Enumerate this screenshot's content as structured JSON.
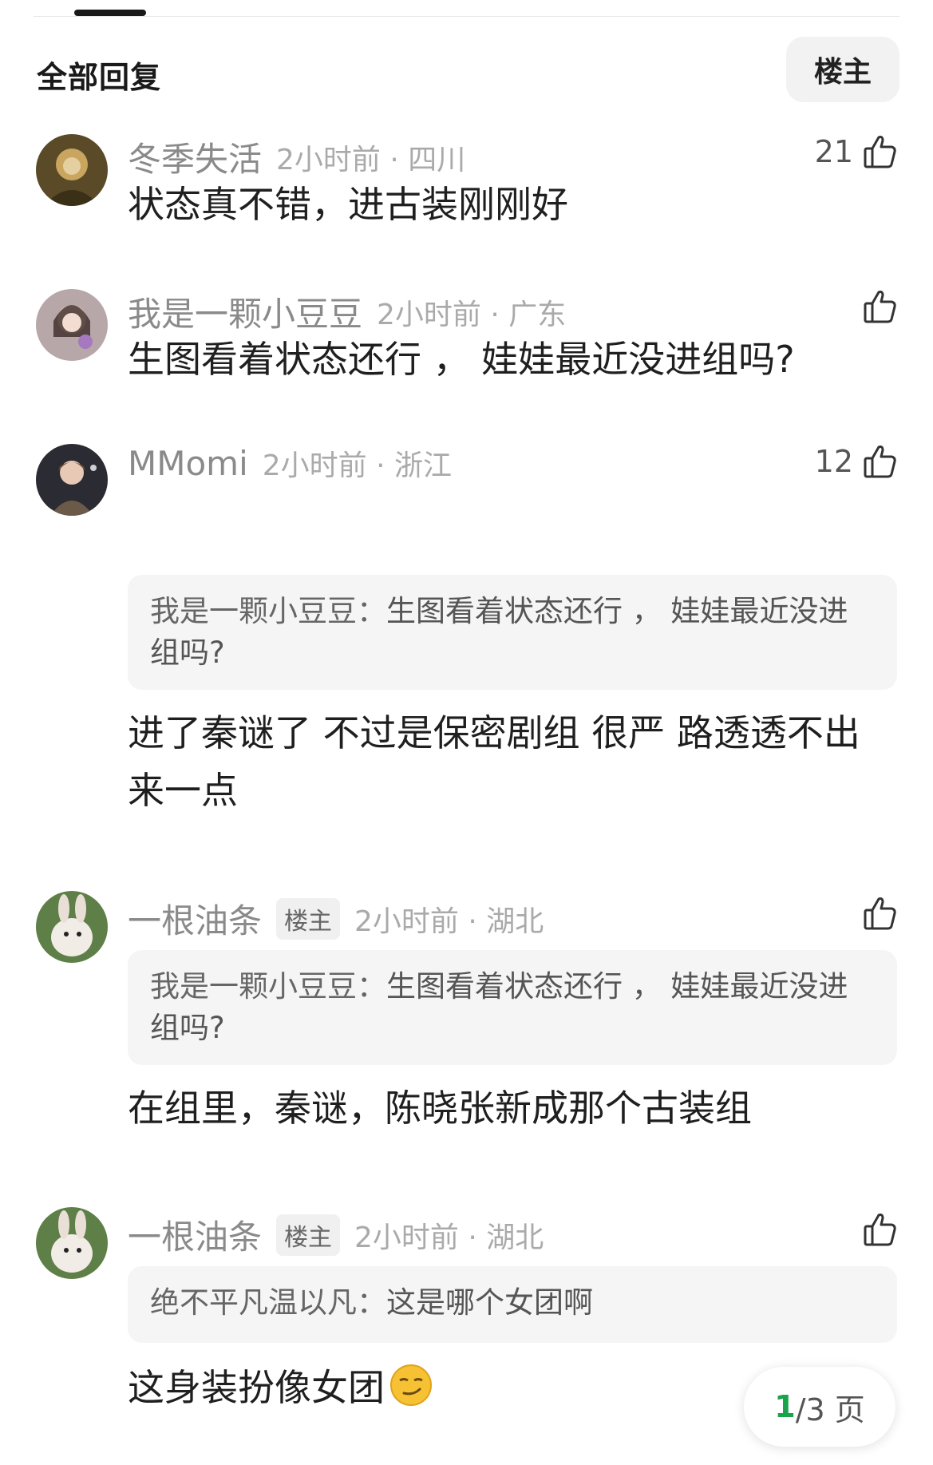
{
  "header": {
    "title": "全部回复",
    "filter_label": "楼主"
  },
  "comments": [
    {
      "user": "冬季失活",
      "time_loc": "2小时前 · 四川",
      "likes": "21",
      "text": "状态真不错，进古装刚刚好"
    },
    {
      "user": "我是一颗小豆豆",
      "time_loc": "2小时前 · 广东",
      "likes": "",
      "text": "生图看着状态还行 ， 娃娃最近没进组吗?"
    },
    {
      "user": "MMomi",
      "time_loc": "2小时前 · 浙江",
      "likes": "12",
      "quote_author": "我是一颗小豆豆：",
      "quote_text": "生图看着状态还行 ， 娃娃最近没进组吗?",
      "text": "进了秦谜了 不过是保密剧组 很严 路透透不出来一点"
    },
    {
      "user": "一根油条",
      "badge": "楼主",
      "time_loc": "2小时前 · 湖北",
      "likes": "",
      "quote_author": "我是一颗小豆豆：",
      "quote_text": "生图看着状态还行 ， 娃娃最近没进组吗?",
      "text": "在组里，秦谜，陈晓张新成那个古装组"
    },
    {
      "user": "一根油条",
      "badge": "楼主",
      "time_loc": "2小时前 · 湖北",
      "likes": "",
      "quote_author": "绝不平凡温以凡：",
      "quote_text": "这是哪个女团啊",
      "text": "这身装扮像女团"
    }
  ],
  "pagination": {
    "current": "1",
    "total": "/3 页"
  },
  "colors": {
    "accent_green": "#1aa34a",
    "meta_gray": "#8a8a8a",
    "quote_bg": "#f5f5f5"
  },
  "icons": {
    "like": "thumbs-up-icon",
    "emoji": "smirk-emoji-icon"
  }
}
